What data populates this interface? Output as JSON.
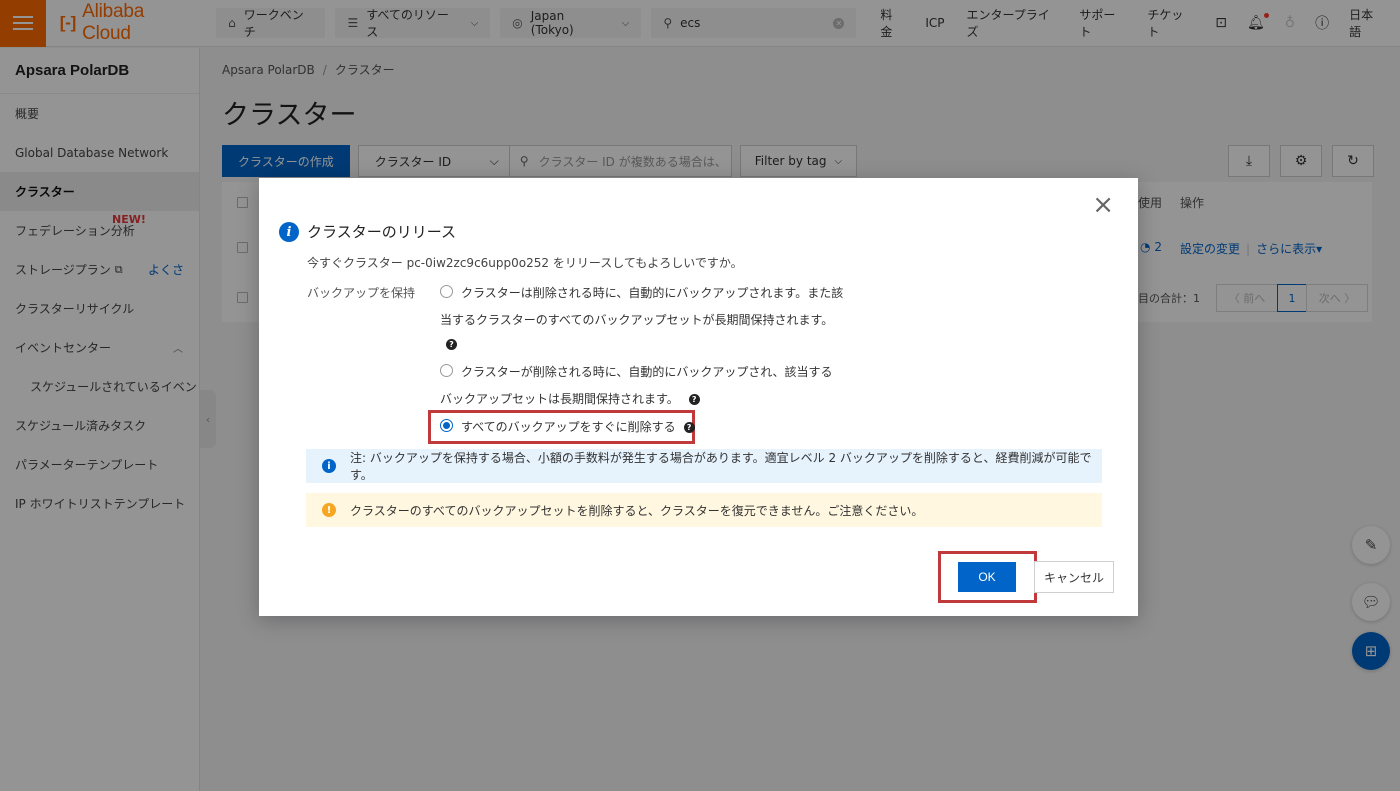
{
  "topbar": {
    "logo_text": "Alibaba Cloud",
    "logo_mark": "[-]",
    "workbench": "ワークベンチ",
    "resources": "すべてのリソース",
    "region": "Japan (Tokyo)",
    "search_value": "ecs",
    "links": [
      "料金",
      "ICP",
      "エンタープライズ",
      "サポート",
      "チケット"
    ],
    "language": "日本語",
    "brand_color": "#ff6a00"
  },
  "sidebar": {
    "title": "Apsara PolarDB",
    "items": [
      {
        "label": "概要"
      },
      {
        "label": "Global Database Network"
      },
      {
        "label": "クラスター"
      },
      {
        "label": "フェデレーション分析"
      },
      {
        "label": "ストレージプラン"
      },
      {
        "label": "クラスターリサイクル"
      },
      {
        "label": "イベントセンター"
      },
      {
        "label": "スケジュールされているイベン"
      },
      {
        "label": "スケジュール済みタスク"
      },
      {
        "label": "パラメーターテンプレート"
      },
      {
        "label": "IP ホワイトリストテンプレート"
      }
    ],
    "new_badge": "NEW!",
    "storage_link": "よくさ"
  },
  "main": {
    "breadcrumb": [
      "Apsara PolarDB",
      "クラスター"
    ],
    "title": "クラスター",
    "create_button": "クラスターの作成",
    "filter_select": "クラスター ID",
    "search_placeholder": "クラスター ID が複数ある場合は、",
    "tag_filter": "Filter by tag",
    "table": {
      "col_usage": "使用",
      "col_ops": "操作",
      "row_usage": "2",
      "row_op_change": "設定の変更",
      "row_op_more": "さらに表示▾"
    },
    "pager": {
      "total": "目の合計：1",
      "prev": "〈 前へ",
      "current": "1",
      "next": "次へ 〉"
    }
  },
  "modal": {
    "title": "クラスターのリリース",
    "description": "今すぐクラスター pc-0iw2zc9c6upp0o252 をリリースしてもよろしいですか。",
    "backup_label": "バックアップを保持",
    "option1_line1": "クラスターは削除される時に、自動的にバックアップされます。また該",
    "option1_line2": "当するクラスターのすべてのバックアップセットが長期間保持されます。",
    "option2_line1": "クラスターが削除される時に、自動的にバックアップされ、該当する",
    "option2_line2": "バックアップセットは長期間保持されます。",
    "option3": "すべてのバックアップをすぐに削除する",
    "note_info": "注: バックアップを保持する場合、小額の手数料が発生する場合があります。適宜レベル 2 バックアップを削除すると、経費削減が可能です。",
    "note_warning": "クラスターのすべてのバックアップセットを削除すると、クラスターを復元できません。ご注意ください。",
    "ok": "OK",
    "cancel": "キャンセル",
    "selected_option": 3,
    "accent_color": "#0064c8",
    "highlight_color": "#c0393b"
  }
}
